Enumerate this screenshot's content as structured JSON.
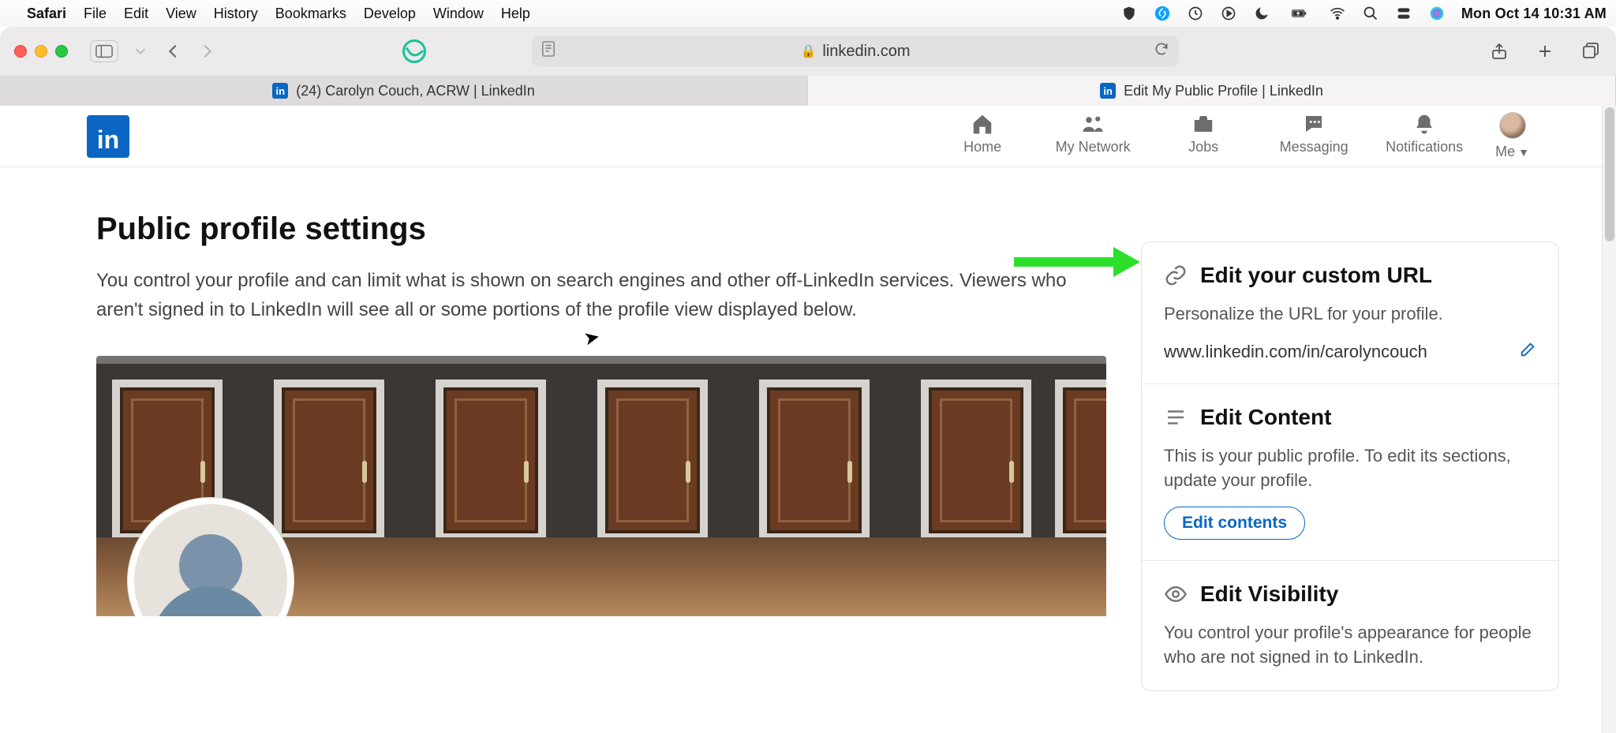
{
  "menubar": {
    "app": "Safari",
    "items": [
      "File",
      "Edit",
      "View",
      "History",
      "Bookmarks",
      "Develop",
      "Window",
      "Help"
    ],
    "clock": "Mon Oct 14  10:31 AM"
  },
  "safari": {
    "address": "linkedin.com",
    "tabs": [
      {
        "title": "(24) Carolyn Couch, ACRW | LinkedIn",
        "active": false
      },
      {
        "title": "Edit My Public Profile | LinkedIn",
        "active": true
      }
    ]
  },
  "linkedin_nav": {
    "home": "Home",
    "network": "My Network",
    "jobs": "Jobs",
    "messaging": "Messaging",
    "notifications": "Notifications",
    "me": "Me"
  },
  "page": {
    "title": "Public profile settings",
    "description": "You control your profile and can limit what is shown on search engines and other off-LinkedIn services. Viewers who aren't signed in to LinkedIn will see all or some portions of the profile view displayed below."
  },
  "rail": {
    "url_card": {
      "title": "Edit your custom URL",
      "desc": "Personalize the URL for your profile.",
      "url": "www.linkedin.com/in/carolyncouch"
    },
    "content_card": {
      "title": "Edit Content",
      "desc": "This is your public profile. To edit its sections, update your profile.",
      "button": "Edit contents"
    },
    "visibility_card": {
      "title": "Edit Visibility",
      "desc": "You control your profile's appearance for people who are not signed in to LinkedIn."
    }
  }
}
